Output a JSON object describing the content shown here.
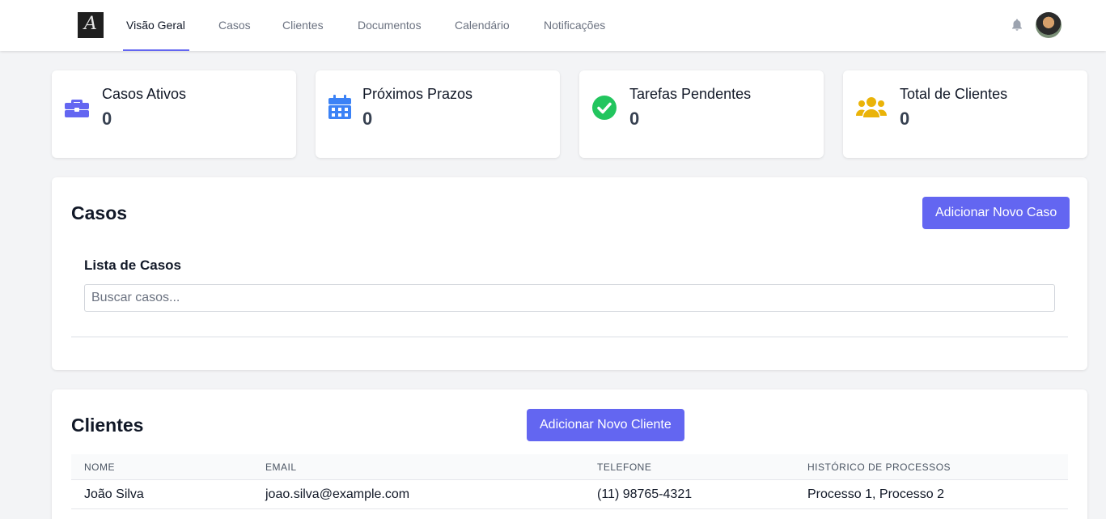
{
  "nav": {
    "logo_letter": "A",
    "items": [
      {
        "label": "Visão Geral",
        "active": true
      },
      {
        "label": "Casos",
        "active": false
      },
      {
        "label": "Clientes",
        "active": false
      },
      {
        "label": "Documentos",
        "active": false
      },
      {
        "label": "Calendário",
        "active": false
      },
      {
        "label": "Notificações",
        "active": false
      }
    ],
    "icons": {
      "bell": "bell-icon",
      "avatar": "user-avatar"
    }
  },
  "stats": [
    {
      "title": "Casos Ativos",
      "value": "0",
      "icon": "briefcase-icon",
      "color": "#6366f1"
    },
    {
      "title": "Próximos Prazos",
      "value": "0",
      "icon": "calendar-icon",
      "color": "#3b82f6"
    },
    {
      "title": "Tarefas Pendentes",
      "value": "0",
      "icon": "check-circle-icon",
      "color": "#22c55e"
    },
    {
      "title": "Total de Clientes",
      "value": "0",
      "icon": "users-icon",
      "color": "#eab308"
    }
  ],
  "cases": {
    "title": "Casos",
    "add_button": "Adicionar Novo Caso",
    "list_title": "Lista de Casos",
    "search_placeholder": "Buscar casos..."
  },
  "clients": {
    "title": "Clientes",
    "add_button": "Adicionar Novo Cliente",
    "columns": [
      "NOME",
      "EMAIL",
      "TELEFONE",
      "HISTÓRICO DE PROCESSOS"
    ],
    "rows": [
      {
        "name": "João Silva",
        "email": "joao.silva@example.com",
        "phone": "(11) 98765-4321",
        "history": "Processo 1, Processo 2"
      }
    ]
  },
  "colors": {
    "accent": "#6366f1",
    "background": "#f3f4f6"
  }
}
